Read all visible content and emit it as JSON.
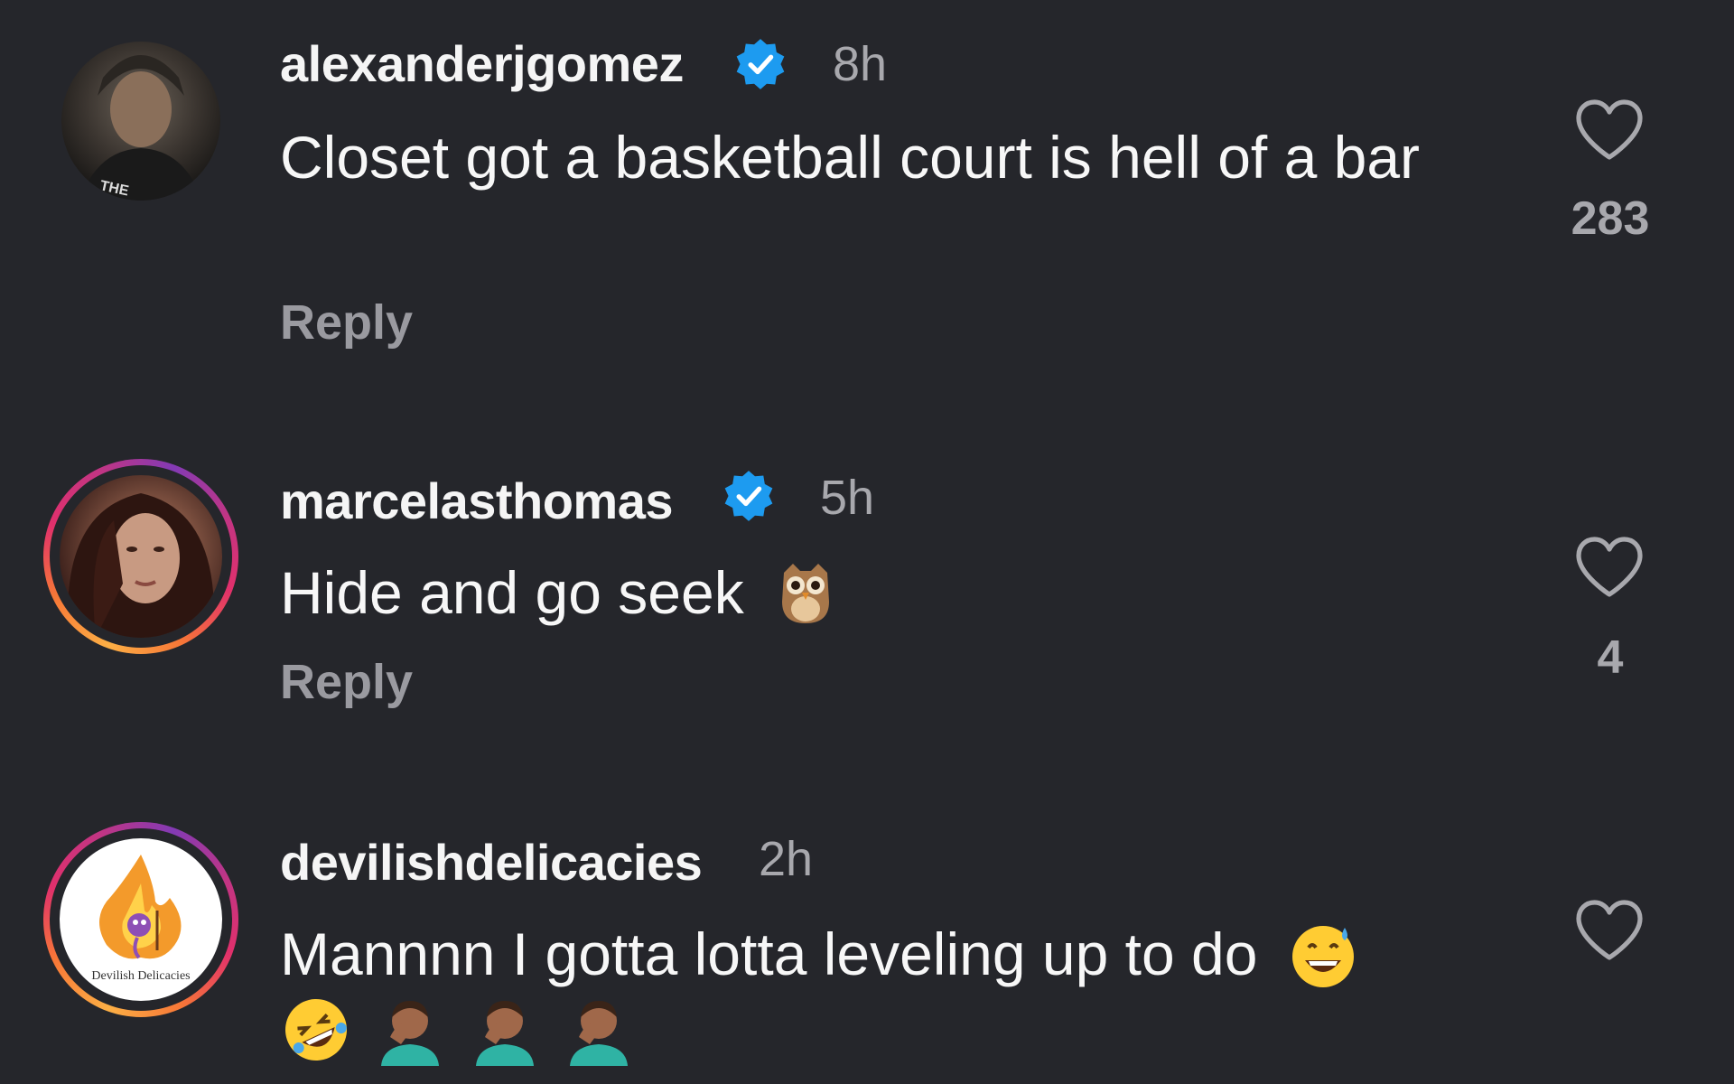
{
  "comments": [
    {
      "username": "alexanderjgomez",
      "verified": true,
      "time": "8h",
      "text": "Closet got a basketball court is hell of a bar",
      "reply_label": "Reply",
      "likes": "283",
      "avatar_caption": "THE"
    },
    {
      "username": "marcelasthomas",
      "verified": true,
      "time": "5h",
      "text": "Hide and go seek",
      "text_emoji": "owl",
      "reply_label": "Reply",
      "likes": "4"
    },
    {
      "username": "devilishdelicacies",
      "verified": false,
      "time": "2h",
      "text": "Mannnn I gotta lotta leveling up to do",
      "text_emoji": [
        "grinning-sweat",
        "rolling-laughing",
        "facepalm",
        "facepalm",
        "facepalm"
      ],
      "likes": "",
      "avatar_logo_text": "Devilish Delicacies"
    }
  ],
  "icons": {
    "verified": "verified-badge-icon",
    "like": "heart-outline-icon"
  },
  "colors": {
    "background": "#25262b",
    "verified": "#1d9bf0",
    "muted": "#a8a8ad"
  }
}
